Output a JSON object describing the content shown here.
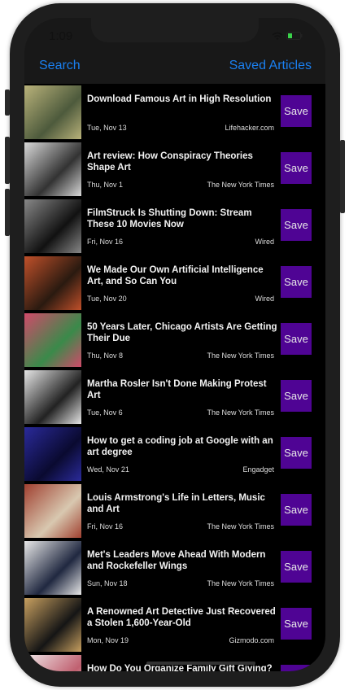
{
  "status": {
    "time": "1:09"
  },
  "nav": {
    "left": "Search",
    "right": "Saved Articles"
  },
  "save_label": "Save",
  "articles": [
    {
      "title": "Download Famous Art in High Resolution",
      "date": "Tue, Nov 13",
      "source": "Lifehacker.com",
      "thumb": [
        "#b9b27a",
        "#4d5a3c"
      ]
    },
    {
      "title": "Art review: How Conspiracy Theories Shape Art",
      "date": "Thu, Nov 1",
      "source": "The New York Times",
      "thumb": [
        "#d8d8d8",
        "#333333"
      ]
    },
    {
      "title": "FilmStruck Is Shutting Down: Stream These 10 Movies Now",
      "date": "Fri, Nov 16",
      "source": "Wired",
      "thumb": [
        "#888888",
        "#111111"
      ]
    },
    {
      "title": "We Made Our Own Artificial Intelligence Art, and So Can You",
      "date": "Tue, Nov 20",
      "source": "Wired",
      "thumb": [
        "#c0502a",
        "#2a1a10"
      ]
    },
    {
      "title": "50 Years Later, Chicago Artists Are Getting Their Due",
      "date": "Thu, Nov 8",
      "source": "The New York Times",
      "thumb": [
        "#d04a6a",
        "#3a8a4a"
      ]
    },
    {
      "title": "Martha Rosler Isn't Done Making Protest Art",
      "date": "Tue, Nov 6",
      "source": "The New York Times",
      "thumb": [
        "#e6e6e6",
        "#222222"
      ]
    },
    {
      "title": "How to get a coding job at Google with an art degree",
      "date": "Wed, Nov 21",
      "source": "Engadget",
      "thumb": [
        "#2a2a9a",
        "#0a0a30"
      ]
    },
    {
      "title": "Louis Armstrong's Life in Letters, Music and Art",
      "date": "Fri, Nov 16",
      "source": "The New York Times",
      "thumb": [
        "#a04030",
        "#d8c8b0"
      ]
    },
    {
      "title": "Met's Leaders Move Ahead With Modern and Rockefeller Wings",
      "date": "Sun, Nov 18",
      "source": "The New York Times",
      "thumb": [
        "#e8e8e8",
        "#202840"
      ]
    },
    {
      "title": "A Renowned Art Detective Just Recovered a Stolen 1,600-Year-Old",
      "date": "Mon, Nov 19",
      "source": "Gizmodo.com",
      "thumb": [
        "#c8a060",
        "#151515"
      ]
    },
    {
      "title": "How Do You Organize Family Gift Giving?",
      "date": "",
      "source": "",
      "thumb": [
        "#f0e8e8",
        "#c06070"
      ]
    }
  ]
}
